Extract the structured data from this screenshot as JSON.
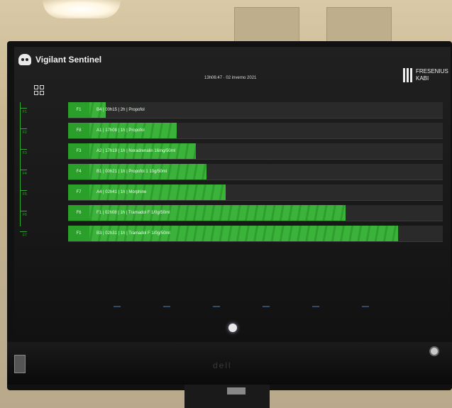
{
  "app": {
    "title": "Vigilant Sentinel",
    "datetime": "13h06:47 · 02 inverno 2021",
    "vendor_line1": "FRESENIUS",
    "vendor_line2": "KABI"
  },
  "rows": [
    {
      "channel": "F1",
      "text": "B4 | 00h15 | 2h | Propofol",
      "fill": 0.1
    },
    {
      "channel": "F8",
      "text": "A1 | 17h08 | 1h | Propofol",
      "fill": 0.29
    },
    {
      "channel": "F3",
      "text": "A2 | 17h19 | 1h | Noradrenalin 16mg/50ml",
      "fill": 0.34
    },
    {
      "channel": "F4",
      "text": "B1 | 00h21 | 1h | Propofol 1 10g/50ml",
      "fill": 0.37
    },
    {
      "channel": "F7",
      "text": "A4 | 02h41 | 1h | Morphine",
      "fill": 0.42
    },
    {
      "channel": "F6",
      "text": "F1 | 02h08 | 1h | Tramadol F 1/0g/50ml",
      "fill": 0.74
    },
    {
      "channel": "F1",
      "text": "B3 | 02h31 | 1h | Tramadol F 1/0g/50ml",
      "fill": 0.88
    }
  ],
  "tick_labels": [
    "F1",
    "F2",
    "F3",
    "F4",
    "F5",
    "F6",
    "F7"
  ],
  "monitor": {
    "brand": "dell"
  },
  "colors": {
    "bar": "#3bb33b",
    "track": "#2a2a2a",
    "accent": "#2ea82e"
  }
}
